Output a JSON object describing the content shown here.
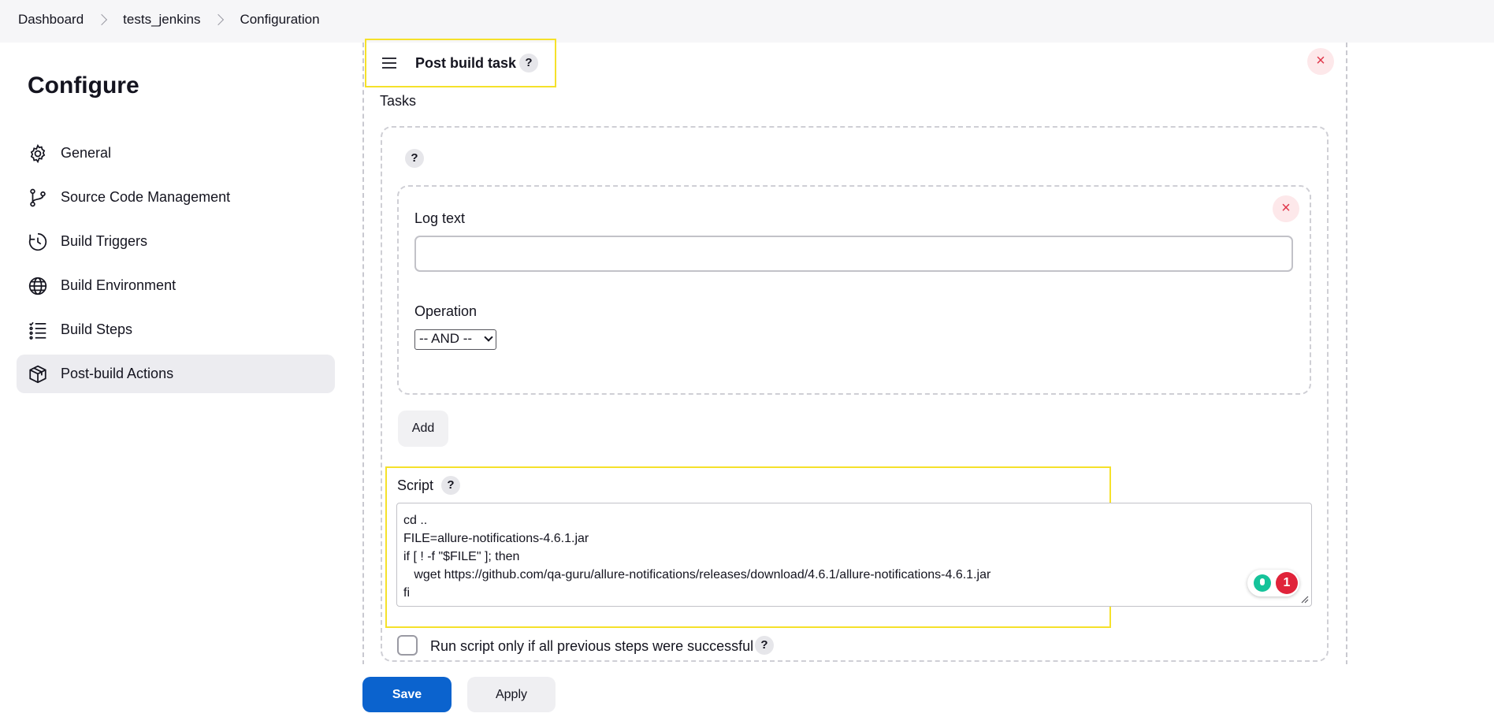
{
  "breadcrumb": [
    "Dashboard",
    "tests_jenkins",
    "Configuration"
  ],
  "page_title": "Configure",
  "sidebar": {
    "items": [
      {
        "label": "General",
        "icon": "gear-icon"
      },
      {
        "label": "Source Code Management",
        "icon": "branch-icon"
      },
      {
        "label": "Build Triggers",
        "icon": "clock-icon"
      },
      {
        "label": "Build Environment",
        "icon": "globe-icon"
      },
      {
        "label": "Build Steps",
        "icon": "list-icon"
      },
      {
        "label": "Post-build Actions",
        "icon": "cube-icon",
        "active": true
      }
    ]
  },
  "post_build": {
    "title": "Post build task",
    "tasks_label": "Tasks",
    "log_text_label": "Log text",
    "log_text_value": "",
    "operation_label": "Operation",
    "operation_value": "-- AND --",
    "add_label": "Add",
    "script_label": "Script",
    "script_lines": [
      "cd ..",
      "FILE=allure-notifications-4.6.1.jar",
      "if [ ! -f \"$FILE\" ]; then",
      "   wget https://github.com/qa-guru/allure-notifications/releases/download/4.6.1/allure-notifications-4.6.1.jar",
      "fi"
    ],
    "grammarly_count": "1",
    "run_if_success_label": "Run script only if all previous steps were successful",
    "run_if_success_checked": false
  },
  "help_glyph": "?",
  "close_glyph": "×",
  "footer": {
    "save_label": "Save",
    "apply_label": "Apply"
  },
  "colors": {
    "accent": "#0b63ce",
    "highlight": "#f5e12a",
    "danger": "#e0364a"
  }
}
